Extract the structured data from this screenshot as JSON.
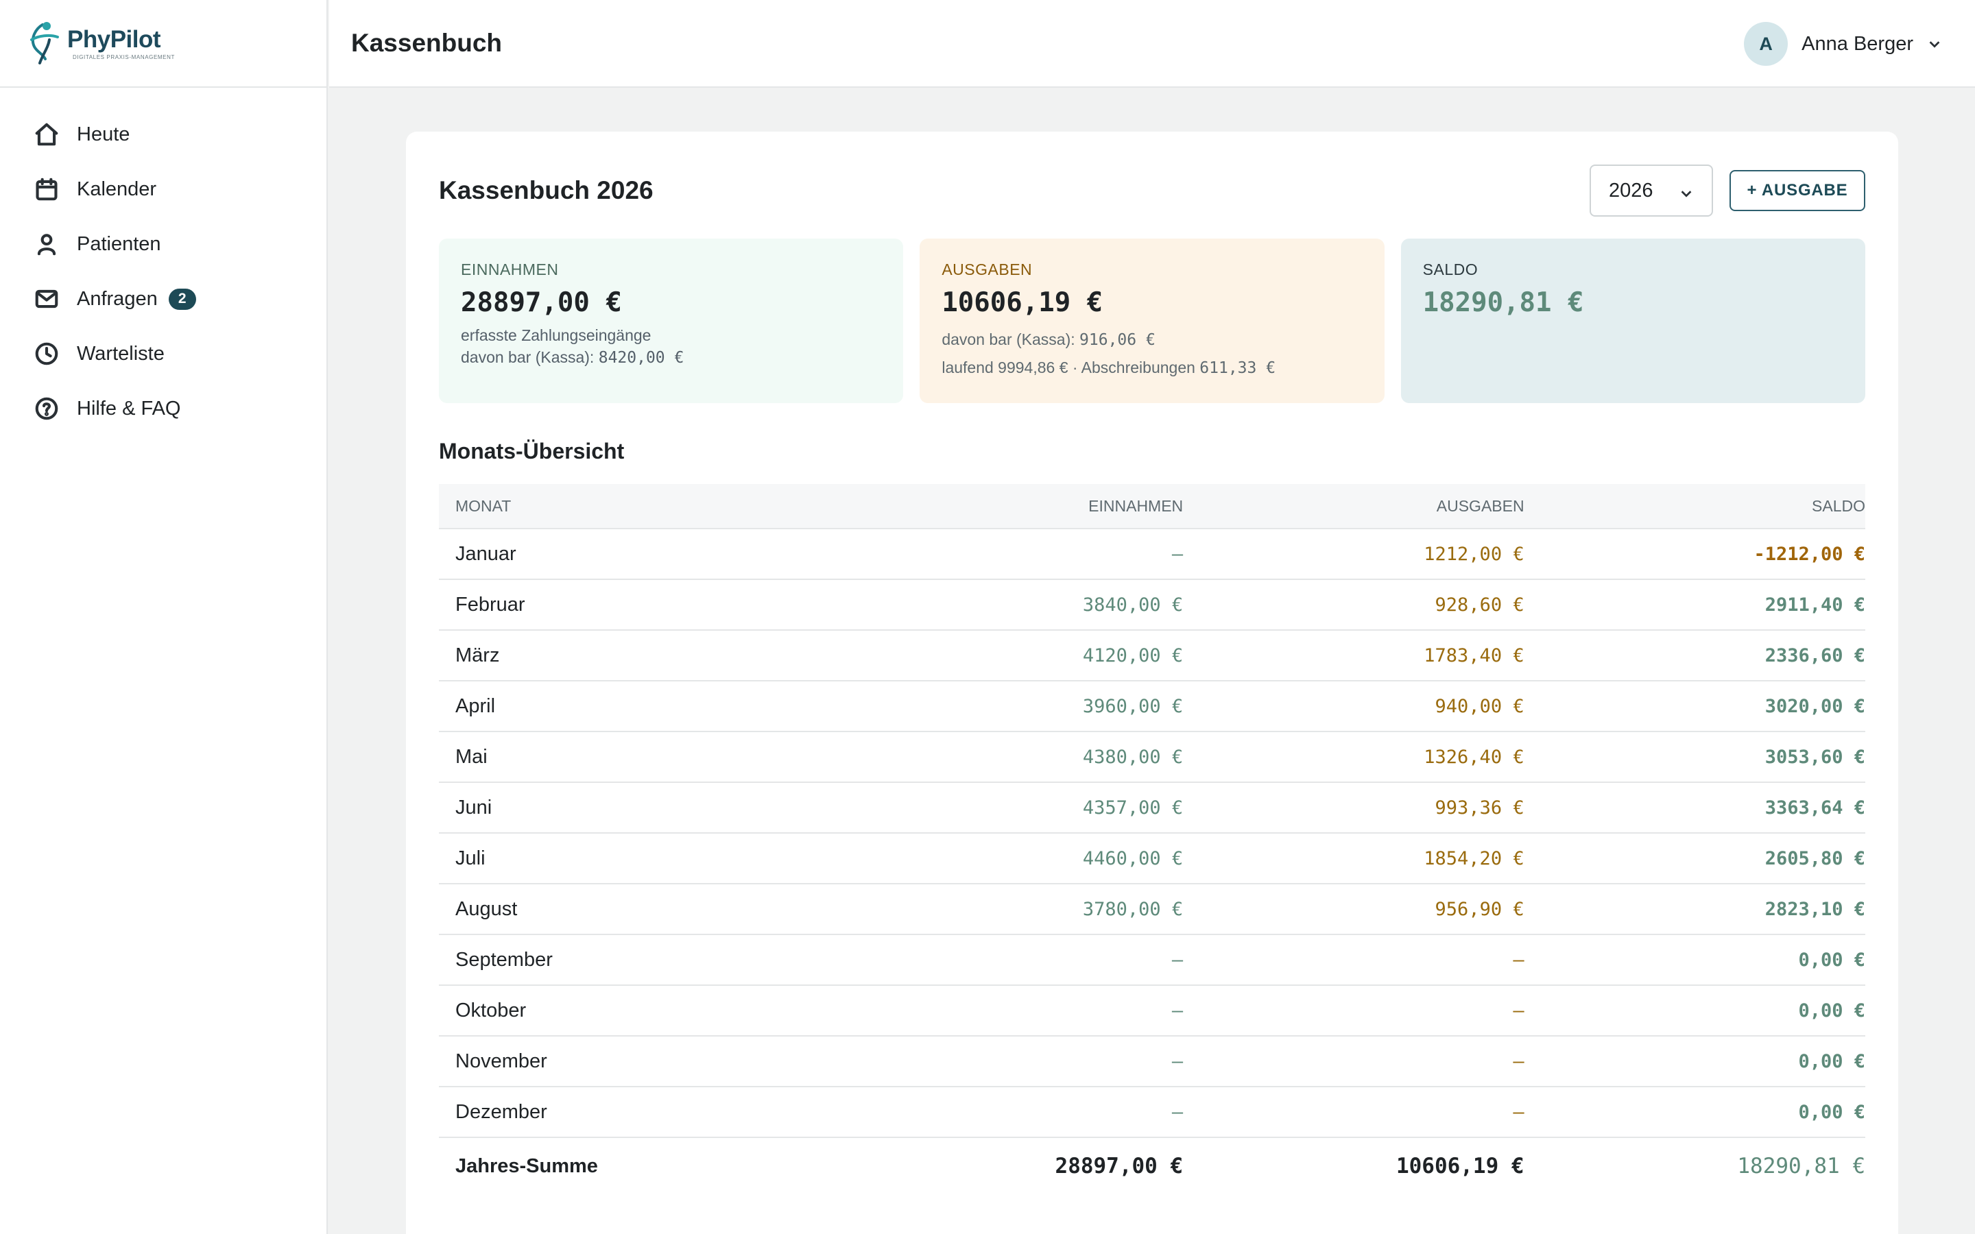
{
  "logo": {
    "name_part1": "Phy",
    "name_part2": "Pilot",
    "tagline": "DIGITALES PRAXIS-MANAGEMENT"
  },
  "sidebar": {
    "items": [
      {
        "label": "Heute",
        "icon": "home-icon"
      },
      {
        "label": "Kalender",
        "icon": "calendar-icon"
      },
      {
        "label": "Patienten",
        "icon": "person-icon"
      },
      {
        "label": "Anfragen",
        "icon": "mail-icon",
        "badge": "2"
      },
      {
        "label": "Warteliste",
        "icon": "clock-icon"
      },
      {
        "label": "Hilfe & FAQ",
        "icon": "help-icon"
      }
    ]
  },
  "header": {
    "title": "Kassenbuch",
    "user": {
      "initial": "A",
      "name": "Anna Berger"
    }
  },
  "card": {
    "title": "Kassenbuch 2026",
    "year_selected": "2026",
    "add_button": "+ AUSGABE"
  },
  "stats": {
    "income": {
      "label": "EINNAHMEN",
      "value": "28897,00 €",
      "sub1": "erfasste Zahlungseingänge",
      "sub2_prefix": "davon bar (Kassa): ",
      "sub2_value": "8420,00 €"
    },
    "expense": {
      "label": "AUSGABEN",
      "value": "10606,19 €",
      "sub1_prefix": "davon bar (Kassa): ",
      "sub1_value": "916,06 €",
      "sub2_prefix": "laufend 9994,86 € · Abschreibungen ",
      "sub2_value": "611,33 €"
    },
    "balance": {
      "label": "SALDO",
      "value": "18290,81 €"
    }
  },
  "overview": {
    "title": "Monats-Übersicht",
    "columns": [
      "MONAT",
      "EINNAHMEN",
      "AUSGABEN",
      "SALDO"
    ],
    "rows": [
      {
        "month": "Januar",
        "income": "—",
        "expense": "1212,00 €",
        "balance": "-1212,00 €"
      },
      {
        "month": "Februar",
        "income": "3840,00 €",
        "expense": "928,60 €",
        "balance": "2911,40 €"
      },
      {
        "month": "März",
        "income": "4120,00 €",
        "expense": "1783,40 €",
        "balance": "2336,60 €"
      },
      {
        "month": "April",
        "income": "3960,00 €",
        "expense": "940,00 €",
        "balance": "3020,00 €"
      },
      {
        "month": "Mai",
        "income": "4380,00 €",
        "expense": "1326,40 €",
        "balance": "3053,60 €"
      },
      {
        "month": "Juni",
        "income": "4357,00 €",
        "expense": "993,36 €",
        "balance": "3363,64 €"
      },
      {
        "month": "Juli",
        "income": "4460,00 €",
        "expense": "1854,20 €",
        "balance": "2605,80 €"
      },
      {
        "month": "August",
        "income": "3780,00 €",
        "expense": "956,90 €",
        "balance": "2823,10 €"
      },
      {
        "month": "September",
        "income": "—",
        "expense": "—",
        "balance": "0,00 €"
      },
      {
        "month": "Oktober",
        "income": "—",
        "expense": "—",
        "balance": "0,00 €"
      },
      {
        "month": "November",
        "income": "—",
        "expense": "—",
        "balance": "0,00 €"
      },
      {
        "month": "Dezember",
        "income": "—",
        "expense": "—",
        "balance": "0,00 €"
      }
    ],
    "total": {
      "label": "Jahres-Summe",
      "income": "28897,00 €",
      "expense": "10606,19 €",
      "balance": "18290,81 €"
    }
  },
  "colors": {
    "brand": "#1d4a56",
    "income": "#5e8a7a",
    "expense": "#9a6b0e",
    "negative": "#a0650a"
  }
}
